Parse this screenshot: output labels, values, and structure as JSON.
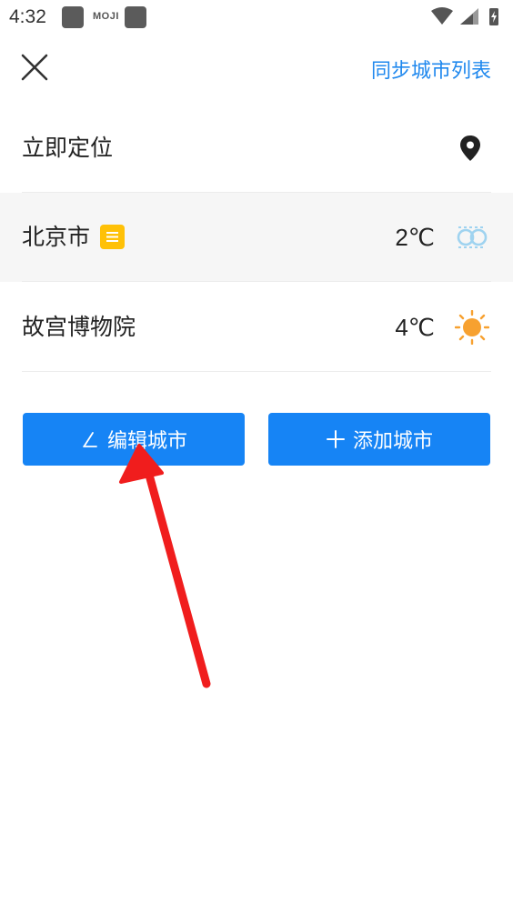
{
  "status_bar": {
    "time": "4:32",
    "app_notification": "MOJI"
  },
  "header": {
    "sync_label": "同步城市列表"
  },
  "locate": {
    "label": "立即定位",
    "icon": "location-pin-icon"
  },
  "cities": [
    {
      "name": "北京市",
      "temp": "2℃",
      "weather_icon": "fog-icon",
      "current_marker": true,
      "color": "#9fd3f0"
    },
    {
      "name": "故宫博物院",
      "temp": "4℃",
      "weather_icon": "sunny-icon",
      "current_marker": false,
      "color": "#f7a130"
    }
  ],
  "actions": {
    "edit_label": "编辑城市",
    "add_label": "添加城市"
  },
  "colors": {
    "accent": "#1684f5",
    "link": "#1f88ee",
    "badge": "#ffc107",
    "annotation_arrow": "#f01d1d"
  }
}
